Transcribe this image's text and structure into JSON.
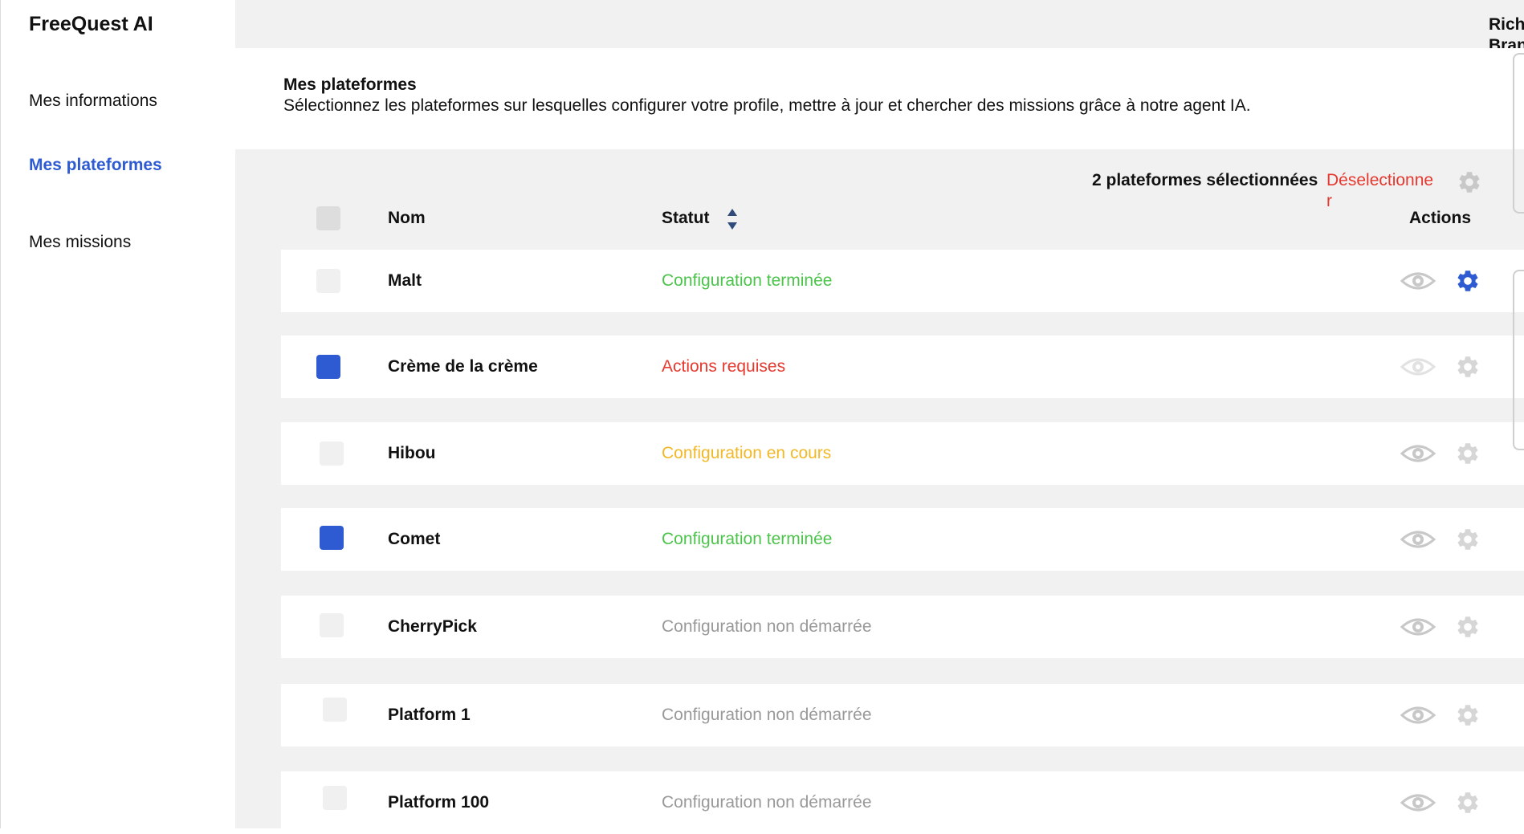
{
  "app": {
    "name": "FreeQuest AI"
  },
  "user": {
    "name_line1": "Rich",
    "name_line2": "Bran"
  },
  "sidebar": {
    "items": [
      {
        "label": "Mes informations",
        "active": false
      },
      {
        "label": "Mes plateformes",
        "active": true
      },
      {
        "label": "Mes missions",
        "active": false
      }
    ]
  },
  "page": {
    "title": "Mes plateformes",
    "description": "Sélectionnez les plateformes sur lesquelles configurer votre profile, mettre à jour et chercher des missions grâce à notre agent IA."
  },
  "selection": {
    "count_label": "2 plateformes sélectionnées",
    "deselect_label": "Déselectionner"
  },
  "table": {
    "headers": {
      "name": "Nom",
      "status": "Statut",
      "actions": "Actions"
    },
    "rows": [
      {
        "name": "Malt",
        "status": "Configuration terminée",
        "checked": false
      },
      {
        "name": "Crème de la crème",
        "status": "Actions requises",
        "checked": true
      },
      {
        "name": "Hibou",
        "status": "Configuration en cours",
        "checked": false
      },
      {
        "name": "Comet",
        "status": "Configuration terminée",
        "checked": true
      },
      {
        "name": "CherryPick",
        "status": "Configuration non démarrée",
        "checked": false
      },
      {
        "name": "Platform 1",
        "status": "Configuration non démarrée",
        "checked": false
      },
      {
        "name": "Platform 100",
        "status": "Configuration non démarrée",
        "checked": false
      }
    ]
  },
  "colors": {
    "accent": "#2e5bd1",
    "status_done": "#4cc44c",
    "status_required": "#e5382e",
    "status_in_progress": "#f2b825",
    "status_not_started": "#999999",
    "icon_inactive": "#c8c8c8",
    "icon_faded": "#e2e2e2"
  },
  "icons": {
    "view": "eye-icon",
    "configure": "gear-icon",
    "sort": "sort-arrows-icon"
  }
}
